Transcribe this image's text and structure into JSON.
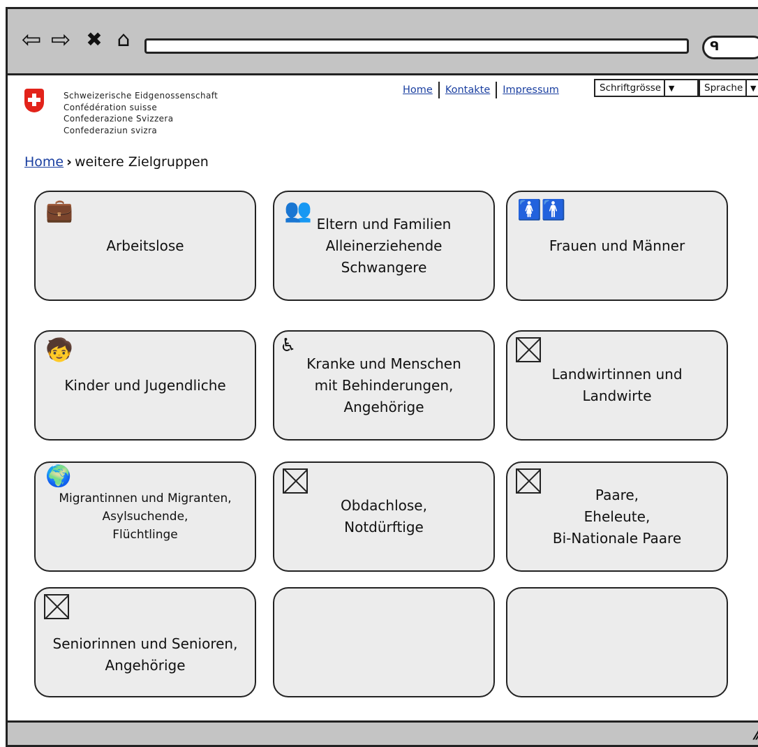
{
  "browser": {
    "back_icon": "back-arrow-icon",
    "forward_icon": "forward-arrow-icon",
    "stop_icon": "close-icon",
    "home_icon": "home-icon",
    "url": "",
    "search_icon": "search-icon"
  },
  "header": {
    "logo_lines": [
      "Schweizerische Eidgenossenschaft",
      "Confédération suisse",
      "Confederazione Svizzera",
      "Confederaziun svizra"
    ],
    "links": [
      "Home",
      "Kontakte",
      "Impressum"
    ],
    "font_size_label": "Schriftgrösse",
    "language_label": "Sprache"
  },
  "breadcrumb": {
    "home": "Home",
    "current": "weitere Zielgruppen"
  },
  "tiles": [
    {
      "label": "Arbeitslose",
      "icon": "briefcase-icon"
    },
    {
      "label": "Eltern und Familien\nAlleinerziehende\nSchwangere",
      "icon": "group-icon"
    },
    {
      "label": "Frauen und Männer",
      "icon": "woman-man-icon"
    },
    {
      "label": "Kinder und Jugendliche",
      "icon": "child-icon"
    },
    {
      "label": "Kranke und Menschen\nmit Behinderungen,\nAngehörige",
      "icon": "wheelchair-icon"
    },
    {
      "label": "Landwirtinnen und\nLandwirte",
      "icon": "image-placeholder-icon"
    },
    {
      "label": "Migrantinnen und Migranten,\nAsylsuchende,\nFlüchtlinge",
      "icon": "globe-icon"
    },
    {
      "label": "Obdachlose,\nNotdürftige",
      "icon": "image-placeholder-icon"
    },
    {
      "label": "Paare,\nEheleute,\nBi-Nationale Paare",
      "icon": "image-placeholder-icon"
    },
    {
      "label": "Seniorinnen und Senioren,\nAngehörige",
      "icon": "image-placeholder-icon"
    },
    {
      "label": "",
      "icon": ""
    },
    {
      "label": "",
      "icon": ""
    }
  ]
}
